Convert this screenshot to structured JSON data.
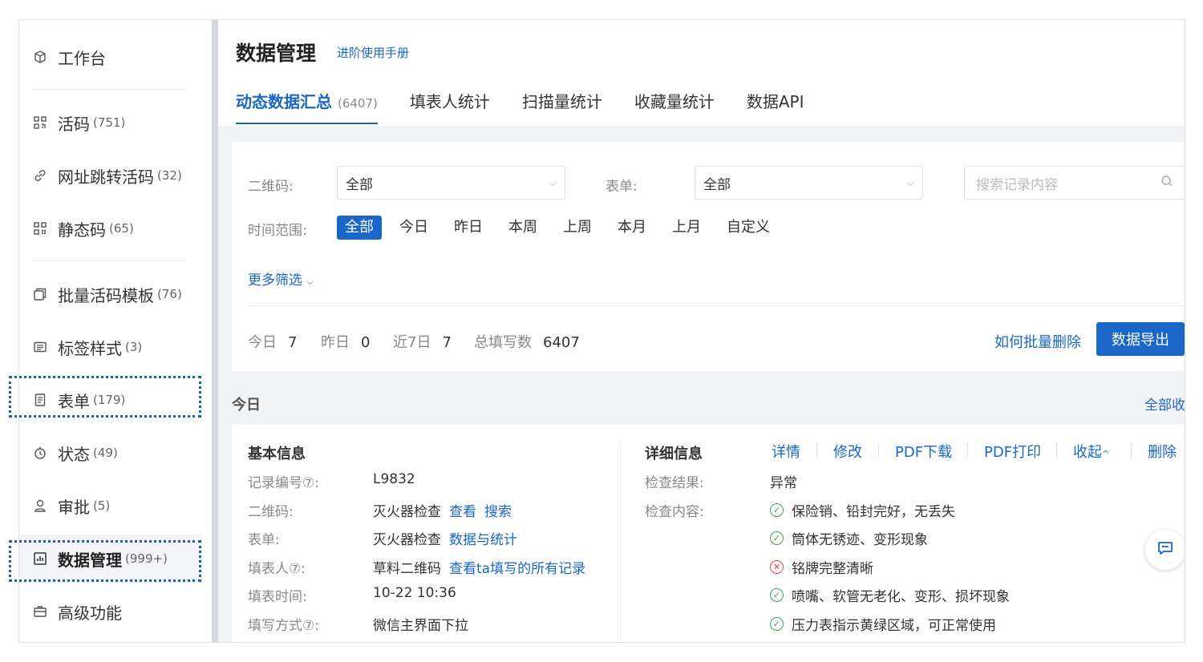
{
  "sidebar": {
    "items": [
      {
        "label": "工作台",
        "count": "",
        "icon": "cube-icon"
      },
      {
        "label": "活码",
        "count": "(751)",
        "icon": "qrcode-icon"
      },
      {
        "label": "网址跳转活码",
        "count": "(32)",
        "icon": "link-icon"
      },
      {
        "label": "静态码",
        "count": "(65)",
        "icon": "qrcode-grid-icon"
      },
      {
        "label": "批量活码模板",
        "count": "(76)",
        "icon": "stack-icon"
      },
      {
        "label": "标签样式",
        "count": "(3)",
        "icon": "label-icon"
      },
      {
        "label": "表单",
        "count": "(179)",
        "icon": "form-icon"
      },
      {
        "label": "状态",
        "count": "(49)",
        "icon": "status-icon"
      },
      {
        "label": "审批",
        "count": "(5)",
        "icon": "approve-icon"
      },
      {
        "label": "数据管理",
        "count": "(999+)",
        "icon": "chart-icon",
        "active": true
      },
      {
        "label": "高级功能",
        "count": "",
        "icon": "briefcase-icon"
      }
    ]
  },
  "header": {
    "title": "数据管理",
    "manual_link": "进阶使用手册",
    "tabs": [
      {
        "label": "动态数据汇总",
        "count": "(6407)",
        "active": true
      },
      {
        "label": "填表人统计",
        "count": ""
      },
      {
        "label": "扫描量统计",
        "count": ""
      },
      {
        "label": "收藏量统计",
        "count": ""
      },
      {
        "label": "数据API",
        "count": ""
      }
    ]
  },
  "filters": {
    "qrcode_label": "二维码:",
    "qrcode_value": "全部",
    "form_label": "表单:",
    "form_value": "全部",
    "search_placeholder": "搜索记录内容",
    "time_label": "时间范围:",
    "time_options": [
      "全部",
      "今日",
      "昨日",
      "本周",
      "上周",
      "本月",
      "上月",
      "自定义"
    ],
    "time_selected": "全部",
    "more_filter": "更多筛选"
  },
  "stats": {
    "today_label": "今日",
    "today_value": "7",
    "yesterday_label": "昨日",
    "yesterday_value": "0",
    "week_label": "近7日",
    "week_value": "7",
    "total_label": "总填写数",
    "total_value": "6407",
    "batch_delete": "如何批量删除",
    "export": "数据导出"
  },
  "group": {
    "day": "今日",
    "collapse_all": "全部收"
  },
  "record": {
    "basic_title": "基本信息",
    "detail_title": "详细信息",
    "basic_rows": [
      {
        "label": "记录编号⑦:",
        "value": "L9832",
        "links": []
      },
      {
        "label": "二维码:",
        "value": "灭火器检查",
        "links": [
          "查看",
          "搜索"
        ]
      },
      {
        "label": "表单:",
        "value": "灭火器检查",
        "links": [
          "数据与统计"
        ]
      },
      {
        "label": "填表人⑦:",
        "value": "草料二维码",
        "links": [
          "查看ta填写的所有记录"
        ]
      },
      {
        "label": "填表时间:",
        "value": "10-22 10:36",
        "links": []
      },
      {
        "label": "填写方式⑦:",
        "value": "微信主界面下拉",
        "links": []
      }
    ],
    "actions": [
      "详情",
      "修改",
      "PDF下载",
      "PDF打印",
      "收起",
      "删除"
    ],
    "result_label": "检查结果:",
    "result_value": "异常",
    "content_label": "检查内容:",
    "check_items": [
      {
        "text": "保险销、铅封完好，无丢失",
        "ok": true
      },
      {
        "text": "筒体无锈迹、变形现象",
        "ok": true
      },
      {
        "text": "铭牌完整清晰",
        "ok": false
      },
      {
        "text": "喷嘴、软管无老化、变形、损坏现象",
        "ok": true
      },
      {
        "text": "压力表指示黄绿区域，可正常使用",
        "ok": true
      }
    ]
  },
  "colors": {
    "accent": "#1a66c9",
    "ok": "#3aa35a",
    "bad": "#e04848",
    "highlight_box": "#1a5fb4"
  }
}
